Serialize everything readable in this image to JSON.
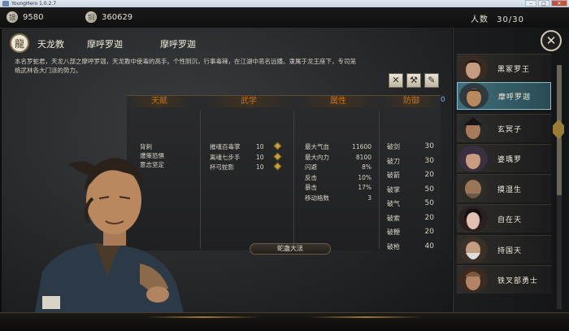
{
  "window": {
    "title": "YoungHero 1.0.2.7"
  },
  "resources": {
    "silver": "9580",
    "copper": "360629",
    "silver_icon": "silver-coin-icon",
    "copper_icon": "copper-coin-icon"
  },
  "party": {
    "label": "人数",
    "count": "30/30"
  },
  "character": {
    "sect": "天龙教",
    "name": "摩呼罗迦",
    "title_name": "摩呼罗迦",
    "description": "本名罗蛇君，天龙八部之摩呼罗迦，天龙教中使毒的高手。个性阴沉，行事毒辣，在江湖中恶名远播。隶属于龙王座下，专司笼络武林各大门派的势力。"
  },
  "stat_headers": {
    "talent": "天赋",
    "martial": "武学",
    "attributes": "属性",
    "defense": "防御",
    "corner_value": "0"
  },
  "talents": [
    "背刺",
    "遭策恐惧",
    "意志坚定"
  ],
  "martial_arts": [
    {
      "name": "摧魂百毒掌",
      "level": "10"
    },
    {
      "name": "离魂七步手",
      "level": "10"
    },
    {
      "name": "杯弓蛇影",
      "level": "10"
    }
  ],
  "attributes": [
    {
      "label": "最大气血",
      "value": "11600"
    },
    {
      "label": "最大内力",
      "value": "8100"
    },
    {
      "label": "闪避",
      "value": "8%"
    },
    {
      "label": "反击",
      "value": "10%"
    },
    {
      "label": "暴击",
      "value": "17%"
    },
    {
      "label": "移动格数",
      "value": "3"
    }
  ],
  "defenses": [
    {
      "label": "破剑",
      "value": "30"
    },
    {
      "label": "破刀",
      "value": "30"
    },
    {
      "label": "破箭",
      "value": "20"
    },
    {
      "label": "破掌",
      "value": "50"
    },
    {
      "label": "破气",
      "value": "50"
    },
    {
      "label": "破索",
      "value": "20"
    },
    {
      "label": "破鞭",
      "value": "20"
    },
    {
      "label": "破枪",
      "value": "40"
    }
  ],
  "skill_button": "蛇蛊大法",
  "roster": [
    "黑冢罗王",
    "摩呼罗迦",
    "玄冥子",
    "婆瑀罗",
    "摸湿生",
    "自在天",
    "持国天",
    "铁叉部勇士"
  ],
  "roster_selected": "摩呼罗迦",
  "colors": {
    "accent": "#c7711c",
    "selected": "#3f6f7a"
  }
}
